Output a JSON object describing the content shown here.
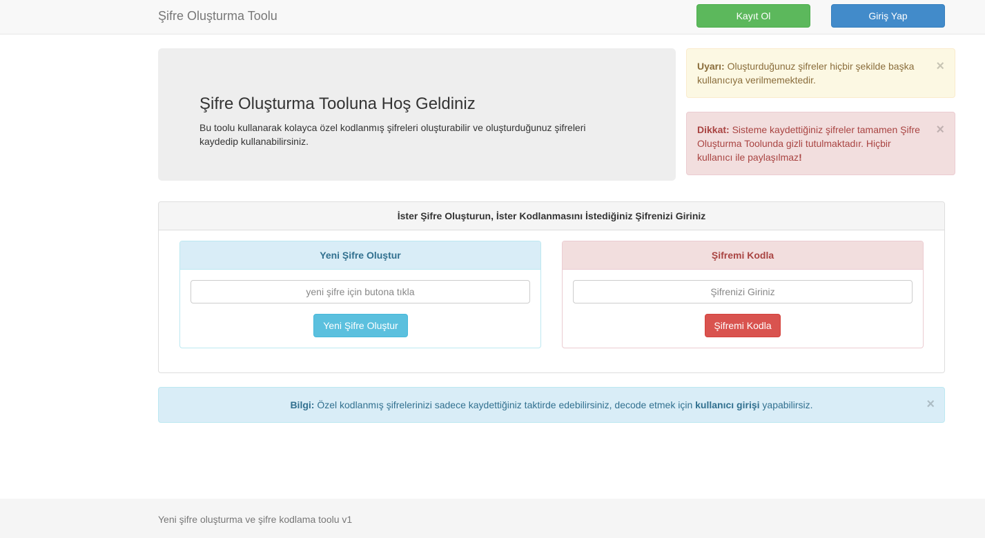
{
  "navbar": {
    "brand": "Şifre Oluşturma Toolu",
    "register_label": "Kayıt Ol",
    "login_label": "Giriş Yap"
  },
  "jumbotron": {
    "title": "Şifre Oluşturma Tooluna Hoş Geldiniz",
    "text": "Bu toolu kullanarak kolayca özel kodlanmış şifreleri oluşturabilir ve oluşturduğunuz şifreleri kaydedip kullanabilirsiniz."
  },
  "alerts": {
    "warning": {
      "label": "Uyarı:",
      "text": " Oluşturduğunuz şifreler hiçbir şekilde başka kullanıcıya verilmemektedir."
    },
    "danger": {
      "label": "Dikkat:",
      "text": " Sisteme kaydettiğiniz şifreler tamamen Şifre Oluşturma Toolunda gizli tutulmaktadır. Hiçbir kullanıcı ile paylaşılmaz",
      "end": "!"
    },
    "info": {
      "label": "Bilgi:",
      "text": " Özel kodlanmış şifrelerinizi sadece kaydettiğiniz taktirde edebilirsiniz, decode etmek için ",
      "link": "kullanıcı girişi",
      "tail": " yapabilirsiz."
    },
    "close_glyph": "×"
  },
  "main_panel": {
    "heading": "İster Şifre Oluşturun, İster Kodlanmasını İstediğiniz Şifrenizi Giriniz",
    "generate": {
      "heading": "Yeni Şifre Oluştur",
      "placeholder": "yeni şifre için butona tıkla",
      "button_label": "Yeni Şifre Oluştur"
    },
    "encode": {
      "heading": "Şifremi Kodla",
      "placeholder": "Şifrenizi Giriniz",
      "button_label": "Şifremi Kodla"
    }
  },
  "footer": {
    "text": "Yeni şifre oluşturma ve şifre kodlama toolu v1"
  },
  "colors": {
    "success": "#5cb85c",
    "primary": "#428bca",
    "info": "#5bc0de",
    "danger": "#d9534f"
  }
}
